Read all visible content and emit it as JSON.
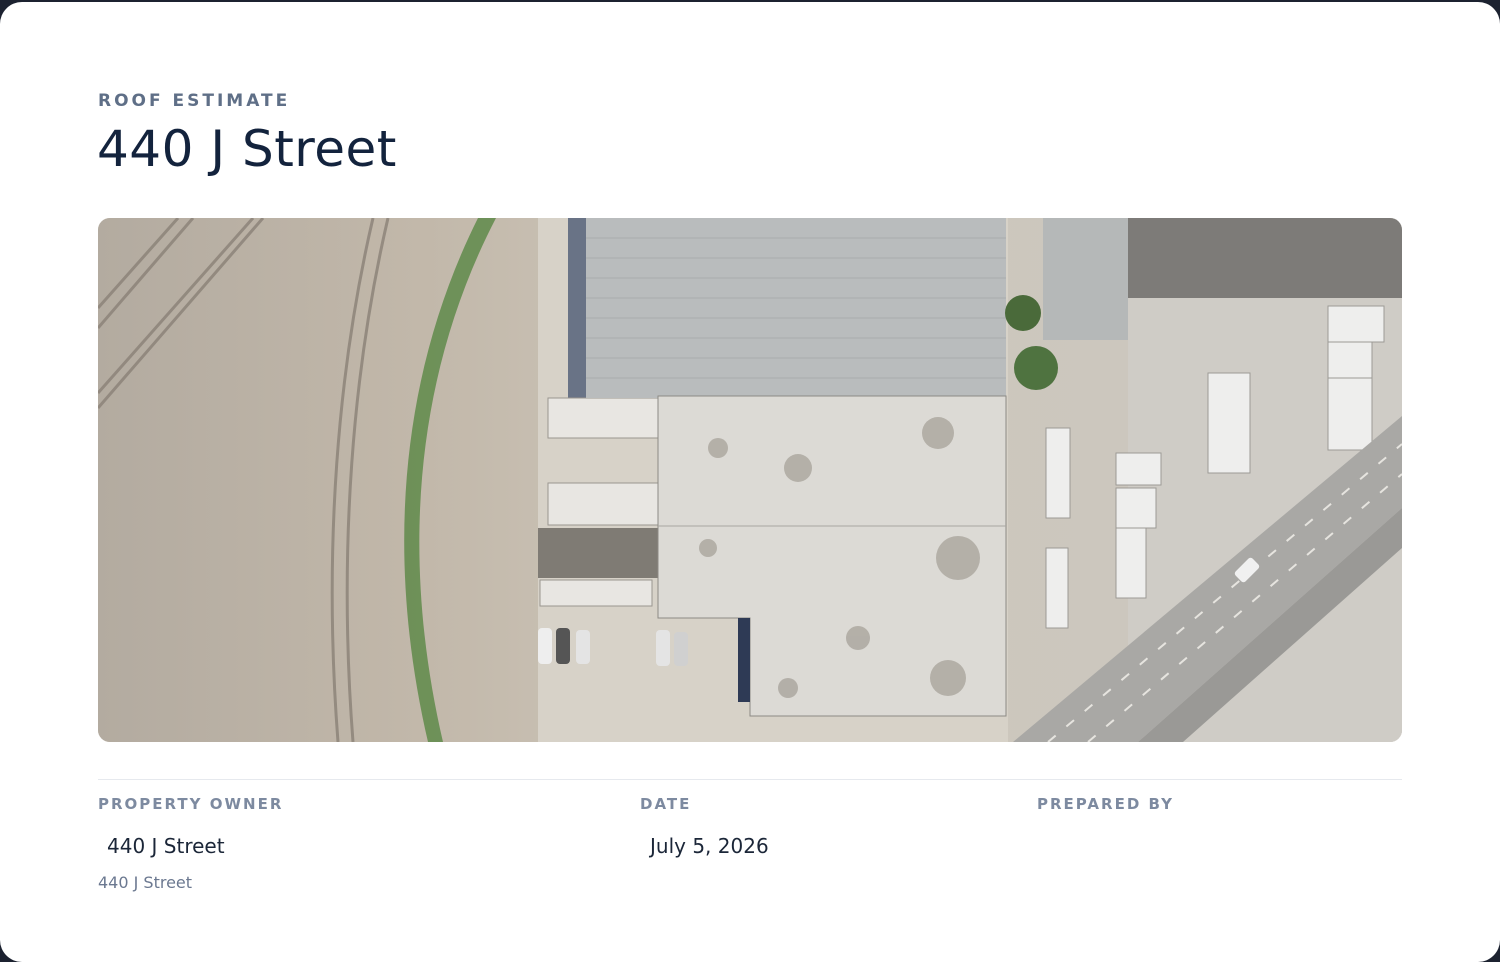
{
  "header": {
    "eyebrow": "ROOF ESTIMATE",
    "title": "440 J Street"
  },
  "details": {
    "owner_label": "PROPERTY OWNER",
    "owner_name": "440 J Street",
    "owner_address": "440 J Street",
    "date_label": "DATE",
    "date_value": "July 5, 2026",
    "prepared_label": "PREPARED BY",
    "prepared_value": ""
  },
  "colors": {
    "title": "#13233d",
    "label": "#7d8aa0",
    "eyebrow": "#5f6f87"
  }
}
